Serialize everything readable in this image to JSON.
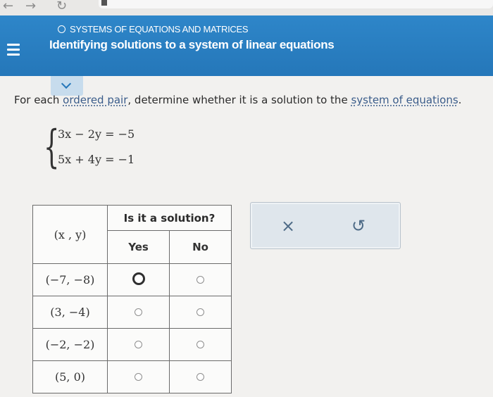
{
  "header": {
    "topic": "SYSTEMS OF EQUATIONS AND MATRICES",
    "title": "Identifying solutions to a system of linear equations"
  },
  "instruction": {
    "prefix": "For each ",
    "link1": "ordered pair",
    "middle": ", determine whether it is a solution to the ",
    "link2": "system of equations",
    "suffix": "."
  },
  "system": {
    "eq1": "3x − 2y = −5",
    "eq2": "5x + 4y = −1"
  },
  "table": {
    "header_question": "Is it a solution?",
    "col_pair": "(x , y)",
    "col_yes": "Yes",
    "col_no": "No",
    "rows": [
      {
        "pair": "(−7, −8)",
        "selected": "yes"
      },
      {
        "pair": "(3, −4)",
        "selected": "none"
      },
      {
        "pair": "(−2, −2)",
        "selected": "none"
      },
      {
        "pair": "(5, 0)",
        "selected": "none"
      }
    ]
  },
  "actions": {
    "clear_icon": "×",
    "undo_icon": "↺"
  },
  "icons": {
    "menu": "hamburger-icon",
    "topic": "circle-outline-icon",
    "collapse": "chevron-down-icon",
    "clear": "x-icon",
    "undo": "undo-icon"
  },
  "colors": {
    "header_blue": "#2a80c2",
    "link": "#3a5c8a"
  }
}
